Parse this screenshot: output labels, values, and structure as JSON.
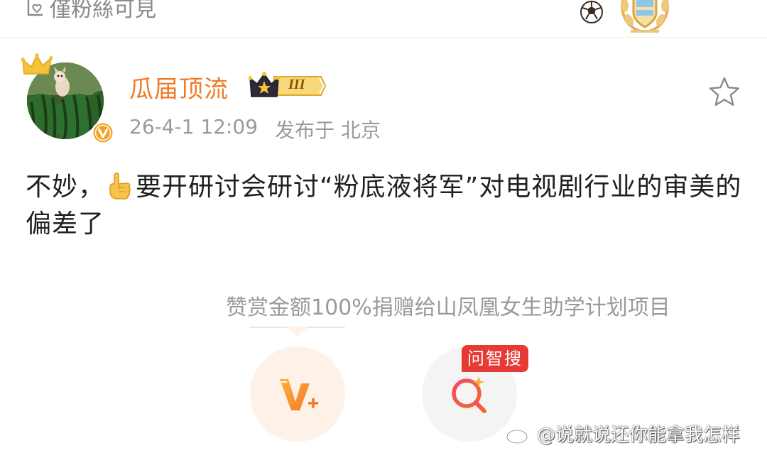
{
  "top_strip": {
    "visibility_label": "僅粉絲可見",
    "icons": [
      "lock-heart-icon",
      "soccer-icon",
      "badge-emblem-icon"
    ]
  },
  "post": {
    "author": {
      "username": "瓜届顶流",
      "level_badge": "III",
      "verified": true,
      "avatar": "watermelon-dog-avatar"
    },
    "timestamp": "26-4-1 12:09",
    "location": "发布于 北京",
    "body_part1": "不妙，",
    "body_icon": "pointing-hand-icon",
    "body_part2": "要开研讨会研讨“粉底液将军”对电视剧行业的审美的偏差了"
  },
  "reward": {
    "text": "赞赏金额100%捐赠给山凤凰女生助学计划项目"
  },
  "actions": {
    "search_tag": "问智搜"
  },
  "watermark": {
    "text": "@说就说还你能拿我怎样"
  },
  "colors": {
    "username": "#f07a25",
    "meta_text": "#9a9a9a",
    "search_tag_bg": "#e63a35",
    "reward_bg": "#fdf1e8"
  }
}
